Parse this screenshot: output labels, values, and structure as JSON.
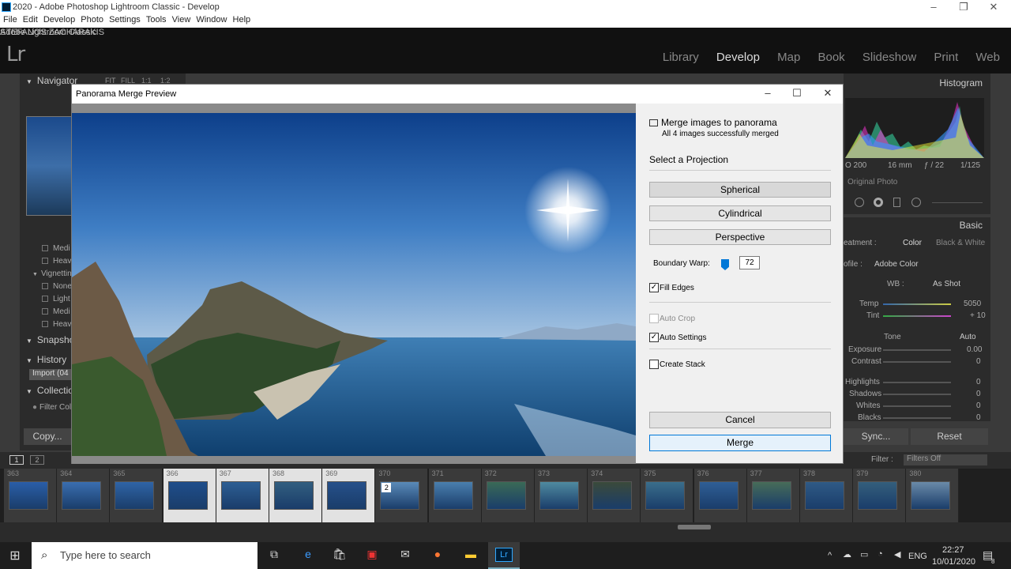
{
  "window": {
    "title": "2020 - Adobe Photoshop Lightroom Classic - Develop"
  },
  "menu": [
    "File",
    "Edit",
    "Develop",
    "Photo",
    "Settings",
    "Tools",
    "View",
    "Window",
    "Help"
  ],
  "identity": {
    "logo": "Lr",
    "app_name": "Adobe Lightroom Classic",
    "user": "STEFANOS ZACHARAKIS"
  },
  "modules": [
    "Library",
    "Develop",
    "Map",
    "Book",
    "Slideshow",
    "Print",
    "Web"
  ],
  "active_module": "Develop",
  "left_panel": {
    "navigator": {
      "label": "Navigator",
      "zoom": [
        "FIT",
        "FILL",
        "1:1",
        "1:2"
      ]
    },
    "presets": [
      "Medi",
      "Heav"
    ],
    "vignetting": {
      "label": "Vignettin",
      "items": [
        "None",
        "Light",
        "Medi",
        "Heav"
      ]
    },
    "snapshots": "Snapsho",
    "history": {
      "label": "History",
      "item": "Import (04"
    },
    "collections": {
      "label": "Collectio",
      "filter": "Filter Col"
    },
    "copy_button": "Copy..."
  },
  "right_panel": {
    "histogram_label": "Histogram",
    "meta": {
      "iso": "O 200",
      "focal": "16 mm",
      "aperture": "ƒ / 22",
      "shutter": "1/125"
    },
    "original_photo": "Original Photo",
    "basic_label": "Basic",
    "treatment": {
      "label": "eatment :",
      "color": "Color",
      "bw": "Black & White"
    },
    "profile": {
      "label": "ofile :",
      "value": "Adobe Color"
    },
    "wb": {
      "label": "WB :",
      "value": "As Shot"
    },
    "temp": {
      "label": "Temp",
      "value": "5050"
    },
    "tint": {
      "label": "Tint",
      "value": "+ 10"
    },
    "tone": {
      "label": "Tone",
      "auto": "Auto"
    },
    "exposure": {
      "label": "Exposure",
      "value": "0.00"
    },
    "contrast": {
      "label": "Contrast",
      "value": "0"
    },
    "highlights": {
      "label": "Highlights",
      "value": "0"
    },
    "shadows": {
      "label": "Shadows",
      "value": "0"
    },
    "whites": {
      "label": "Whites",
      "value": "0"
    },
    "blacks": {
      "label": "Blacks",
      "value": "0"
    },
    "sync_button": "Sync...",
    "reset_button": "Reset"
  },
  "filmbar": {
    "view1": "1",
    "view2": "2",
    "filter_label": "Filter :",
    "filter_value": "Filters Off"
  },
  "filmstrip": {
    "numbers": [
      "363",
      "364",
      "365",
      "366",
      "367",
      "368",
      "369",
      "370",
      "371",
      "372",
      "373",
      "374",
      "375",
      "376",
      "377",
      "378",
      "379",
      "380"
    ],
    "selected": [
      "366",
      "367",
      "368",
      "369"
    ],
    "stack_badge": "2"
  },
  "dialog": {
    "title": "Panorama Merge Preview",
    "header": "Merge images to panorama",
    "status": "All 4 images successfully merged",
    "projection_label": "Select a Projection",
    "projections": [
      "Spherical",
      "Cylindrical",
      "Perspective"
    ],
    "active_projection": "Spherical",
    "boundary_warp": {
      "label": "Boundary Warp:",
      "value": "72"
    },
    "fill_edges": {
      "label": "Fill Edges",
      "checked": true
    },
    "auto_crop": {
      "label": "Auto Crop",
      "checked": false,
      "enabled": false
    },
    "auto_settings": {
      "label": "Auto Settings",
      "checked": true
    },
    "create_stack": {
      "label": "Create Stack",
      "checked": false
    },
    "cancel_button": "Cancel",
    "merge_button": "Merge"
  },
  "taskbar": {
    "search_placeholder": "Type here to search",
    "lang": "ENG",
    "time": "22:27",
    "date": "10/01/2020",
    "notifications": "8"
  }
}
